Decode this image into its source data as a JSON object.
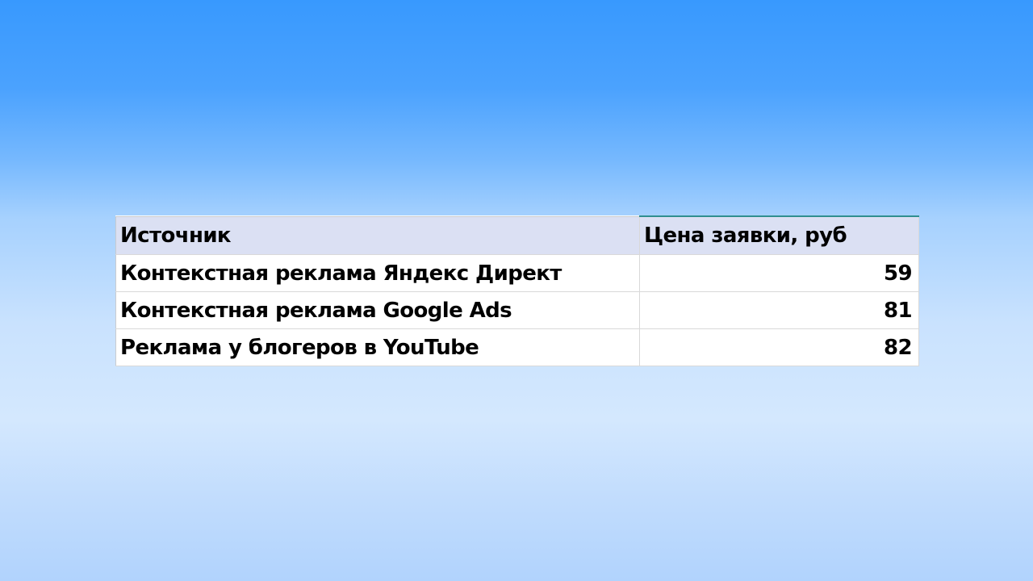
{
  "table": {
    "headers": [
      "Источник",
      "Цена заявки, руб"
    ],
    "rows": [
      {
        "source": "Контекстная реклама Яндекс Директ",
        "price": "59"
      },
      {
        "source": "Контекстная реклама Google Ads",
        "price": "81"
      },
      {
        "source": "Реклама у блогеров в YouTube",
        "price": "82"
      }
    ]
  }
}
